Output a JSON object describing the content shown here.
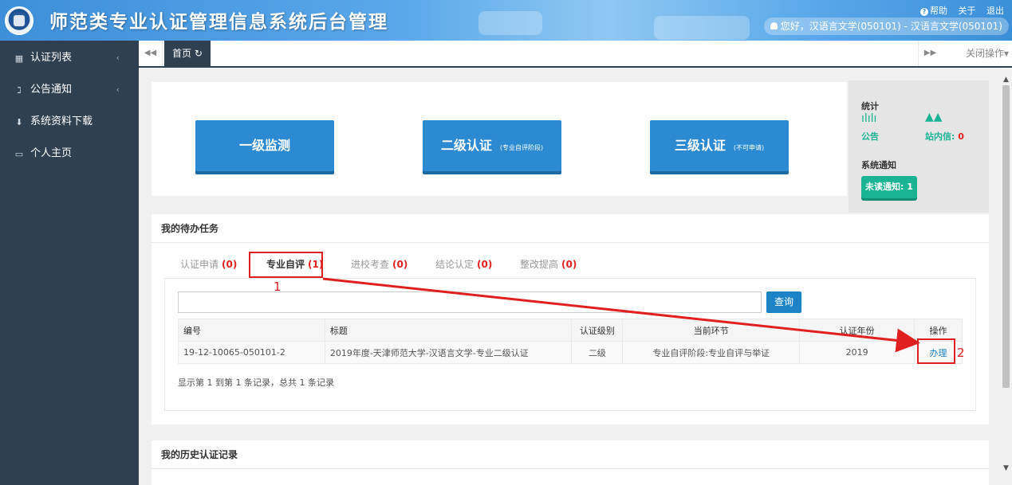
{
  "header": {
    "title": "师范类专业认证管理信息系统后台管理",
    "help": "帮助",
    "about": "关于",
    "logout": "退出",
    "user": "您好，汉语言文学(050101) - 汉语言文学(050101)"
  },
  "sidebar": {
    "items": [
      {
        "label": "认证列表",
        "icon": "calendar-icon",
        "chevron": "‹"
      },
      {
        "label": "公告通知",
        "icon": "rss-icon",
        "chevron": "‹"
      },
      {
        "label": "系统资料下载",
        "icon": "download-icon",
        "chevron": ""
      },
      {
        "label": "个人主页",
        "icon": "monitor-icon",
        "chevron": ""
      }
    ]
  },
  "tabbar": {
    "home": "首页",
    "close_ops": "关闭操作▾"
  },
  "actions": {
    "level1": "一级监测",
    "level2": "二级认证",
    "level2_note": "(专业自评阶段)",
    "level3": "三级认证",
    "level3_note": "(不可申请)"
  },
  "stats": {
    "title": "统计",
    "notice_label": "公告",
    "message_label": "站内信:",
    "message_count": "0",
    "system_notice": "系统通知",
    "unread": "未读通知: 1"
  },
  "todo": {
    "title": "我的待办任务",
    "tabs": [
      {
        "label": "认证申请",
        "count": "(0)"
      },
      {
        "label": "专业自评",
        "count": "(1)"
      },
      {
        "label": "进校考查",
        "count": "(0)"
      },
      {
        "label": "结论认定",
        "count": "(0)"
      },
      {
        "label": "整改提高",
        "count": "(0)"
      }
    ],
    "search_button": "查询",
    "columns": [
      "编号",
      "标题",
      "认证级别",
      "当前环节",
      "认证年份",
      "操作"
    ],
    "rows": [
      {
        "id": "19-12-10065-050101-2",
        "title": "2019年度-天津师范大学-汉语言文学-专业二级认证",
        "level": "二级",
        "stage": "专业自评阶段:专业自评与举证",
        "year": "2019",
        "action": "办理"
      }
    ],
    "page_info": "显示第 1 到第 1 条记录，总共 1 条记录"
  },
  "annotations": {
    "one": "1",
    "two": "2"
  },
  "history": {
    "title": "我的历史认证记录"
  },
  "colors": {
    "sidebar": "#2f4050",
    "header": "#4a9be0",
    "primary_button": "#2b8ad2",
    "green": "#1ab394",
    "annotation_red": "#e02020"
  }
}
